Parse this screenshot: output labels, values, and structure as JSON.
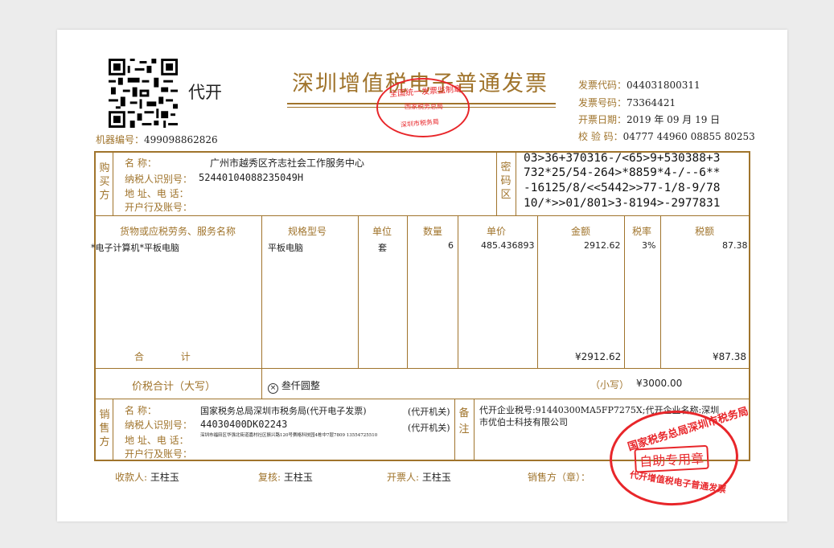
{
  "header": {
    "qr_label": "代开",
    "machine_no_label": "机器编号：",
    "machine_no": "499098862826",
    "title": "深圳增值税电子普通发票",
    "invoice_code_label": "发票代码：",
    "invoice_code": "044031800311",
    "invoice_no_label": "发票号码：",
    "invoice_no": "73364421",
    "date_label": "开票日期：",
    "date_value": "2019 年 09 月 19 日",
    "check_label": "校 验 码：",
    "check_code": "04777 44960 08855 80253"
  },
  "buyer": {
    "section_label": "购买方",
    "name_label": "名        称：",
    "name": "广州市越秀区齐志社会工作服务中心",
    "tax_id_label": "纳税人识别号：",
    "tax_id": "52440104088235049H",
    "address_label": "地 址、电 话：",
    "bank_label": "开户行及账号："
  },
  "cipher": {
    "label": "密码区",
    "lines": [
      "03>36+370316-/<65>9+530388+3",
      "732*25/54-264>*8859*4-/--6**",
      "-16125/8/<<5442>>77-1/8-9/78",
      "10/*>>01/801>3-8194>-2977831"
    ]
  },
  "items": {
    "headers": {
      "name": "货物或应税劳务、服务名称",
      "spec": "规格型号",
      "unit": "单位",
      "qty": "数量",
      "price": "单价",
      "amount": "金额",
      "rate": "税率",
      "tax": "税额"
    },
    "rows": [
      {
        "name": "*电子计算机*平板电脑",
        "spec": "平板电脑",
        "unit": "套",
        "qty": "6",
        "price": "485.436893",
        "amount": "2912.62",
        "rate": "3%",
        "tax": "87.38"
      }
    ],
    "total_label": "合            计",
    "total_amount": "¥2912.62",
    "total_tax": "¥87.38"
  },
  "sum": {
    "label": "价税合计（大写）",
    "upper_icon": "circle-x-icon",
    "upper": "叁仟圆整",
    "lower_label": "（小写）",
    "lower": "¥3000.00"
  },
  "seller": {
    "section_label": "销售方",
    "name_label": "名        称：",
    "name": "国家税务总局深圳市税务局(代开电子发票)",
    "tax_id_label": "纳税人识别号：",
    "tax_id": "44030400DK02243",
    "address_label": "地 址、电 话：",
    "address": "深圳市福田区华强北街道嘉村社区振兴路120号赛格科技园4栋中7层7809  13554725510",
    "bank_label": "开户行及账号：",
    "agent_tag_1": "(代开机关)",
    "agent_tag_2": "(代开机关)"
  },
  "remark": {
    "label": "备注",
    "line1": "代开企业税号:91440300MA5FP7275X;代开企业名称:深圳",
    "line2": "市优伯士科技有限公司"
  },
  "footer": {
    "payee_label": "收款人:",
    "payee": "王柱玉",
    "reviewer_label": "复核:",
    "reviewer": "王柱玉",
    "issuer_label": "开票人:",
    "issuer": "王柱玉",
    "seller_label": "销售方（章）："
  },
  "stamps": {
    "top_outer": "全国统一发票监制章",
    "top_mid": "国家税务总局",
    "top_bottom": "深圳市税务局",
    "right_outer": "国家税务总局深圳市税务局",
    "right_center": "自助专用章",
    "right_bottom": "代开增值税电子普通发票"
  },
  "colors": {
    "frame": "#a0742c",
    "stamp": "#e8262a",
    "text": "#222222"
  }
}
